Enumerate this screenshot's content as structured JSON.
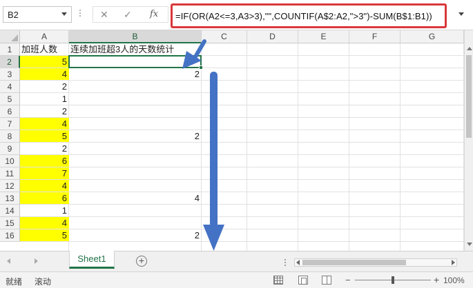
{
  "formula_bar": {
    "name_box": "B2",
    "cancel_icon": "✕",
    "enter_icon": "✓",
    "function_icon": "fx",
    "formula": "=IF(OR(A2<=3,A3>3),\"\",COUNTIF(A$2:A2,\">3\")-SUM(B$1:B1))"
  },
  "columns": [
    "A",
    "B",
    "C",
    "D",
    "E",
    "F",
    "G"
  ],
  "rows": [
    "1",
    "2",
    "3",
    "4",
    "5",
    "6",
    "7",
    "8",
    "9",
    "10",
    "11",
    "12",
    "13",
    "14",
    "15",
    "16"
  ],
  "cells": {
    "A": [
      "加班人数",
      "5",
      "4",
      "2",
      "1",
      "2",
      "4",
      "5",
      "2",
      "6",
      "7",
      "4",
      "6",
      "1",
      "4",
      "5"
    ],
    "B": [
      "连续加班超3人的天数统计",
      "",
      "2",
      "",
      "",
      "",
      "",
      "2",
      "",
      "",
      "",
      "",
      "4",
      "",
      "",
      "2"
    ]
  },
  "highlighted_rows": [
    2,
    3,
    7,
    8,
    10,
    11,
    12,
    13,
    15,
    16
  ],
  "highlight_color": "#ffff00",
  "active_cell": "B2",
  "sheet_tabs": {
    "active": "Sheet1",
    "add_label": "+"
  },
  "status_bar": {
    "ready": "就绪",
    "scroll": "滚动",
    "zoom": "100%"
  },
  "colors": {
    "accent": "#217346",
    "formula_box_border": "#d9383a",
    "annotation_arrow": "#4472c4"
  }
}
